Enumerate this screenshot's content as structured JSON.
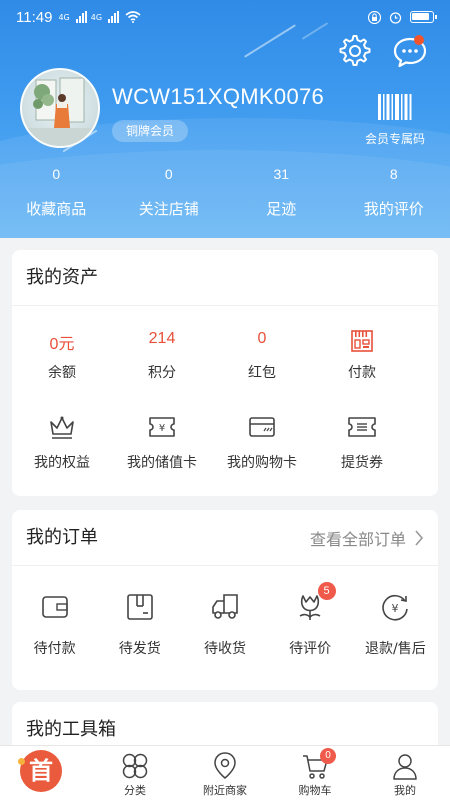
{
  "status_bar": {
    "time": "11:49",
    "network_1": "4G",
    "network_2": "4G"
  },
  "header": {
    "settings_icon": "gear-icon",
    "messages_icon": "chat-bubble-icon",
    "username": "WCW151XQMK0076",
    "member_level": "铜牌会员",
    "member_code_label": "会员专属码",
    "stats": [
      {
        "value": "0",
        "label": "收藏商品"
      },
      {
        "value": "0",
        "label": "关注店铺"
      },
      {
        "value": "31",
        "label": "足迹"
      },
      {
        "value": "8",
        "label": "我的评价"
      }
    ]
  },
  "assets": {
    "title": "我的资产",
    "row1": [
      {
        "value": "0元",
        "label": "余额"
      },
      {
        "value": "214",
        "label": "积分"
      },
      {
        "value": "0",
        "label": "红包"
      },
      {
        "icon": "qr-payment-icon",
        "label": "付款"
      }
    ],
    "row2": [
      {
        "icon": "crown-icon",
        "label": "我的权益"
      },
      {
        "icon": "yuan-card-icon",
        "label": "我的储值卡"
      },
      {
        "icon": "shopping-card-icon",
        "label": "我的购物卡"
      },
      {
        "icon": "voucher-icon",
        "label": "提货券"
      }
    ]
  },
  "orders": {
    "title": "我的订单",
    "view_all": "查看全部订单",
    "items": [
      {
        "icon": "wallet-icon",
        "label": "待付款"
      },
      {
        "icon": "package-icon",
        "label": "待发货"
      },
      {
        "icon": "truck-icon",
        "label": "待收货"
      },
      {
        "icon": "flower-icon",
        "label": "待评价",
        "badge": "5"
      },
      {
        "icon": "refund-icon",
        "label": "退款/售后"
      }
    ]
  },
  "tools": {
    "title": "我的工具箱"
  },
  "bottom_nav": {
    "home_char": "首",
    "items": [
      {
        "label": "分类"
      },
      {
        "label": "附近商家"
      },
      {
        "label": "购物车",
        "badge": "0"
      },
      {
        "label": "我的"
      }
    ]
  },
  "colors": {
    "header_blue": "#3f9bef",
    "accent_red": "#e8503a"
  }
}
